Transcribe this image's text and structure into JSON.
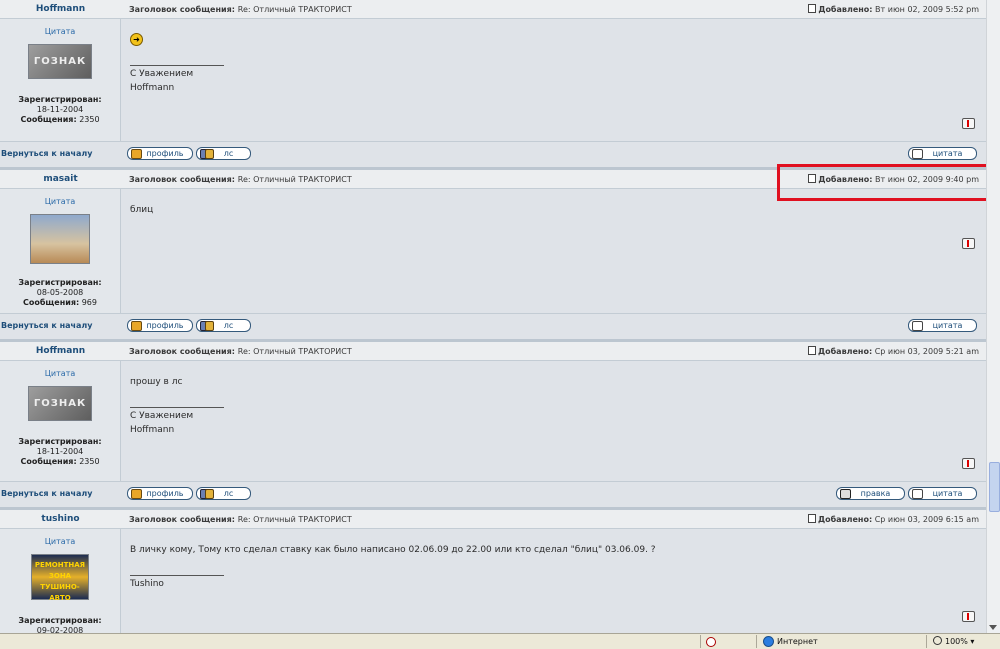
{
  "posts": [
    {
      "author": "Hoffmann",
      "rank": "Цитата",
      "avatar_text": "ГОЗНАК",
      "registered_label": "Зарегистрирован:",
      "registered": "18-11-2004",
      "posts_label": "Сообщения:",
      "posts_count": "2350",
      "subject_label": "Заголовок сообщения:",
      "subject": "Re: Отличный ТРАКТОРИСТ",
      "date_label": "Добавлено:",
      "date": "Вт июн 02, 2009 5:52 pm",
      "body": [],
      "signature": [
        "С Уважением",
        "Hoffmann"
      ]
    },
    {
      "author": "masait",
      "rank": "Цитата",
      "registered_label": "Зарегистрирован:",
      "registered": "08-05-2008",
      "posts_label": "Сообщения:",
      "posts_count": "969",
      "subject_label": "Заголовок сообщения:",
      "subject": "Re: Отличный ТРАКТОРИСТ",
      "date_label": "Добавлено:",
      "date": "Вт июн 02, 2009 9:40 pm",
      "body": [
        "блиц"
      ],
      "signature": []
    },
    {
      "author": "Hoffmann",
      "rank": "Цитата",
      "avatar_text": "ГОЗНАК",
      "registered_label": "Зарегистрирован:",
      "registered": "18-11-2004",
      "posts_label": "Сообщения:",
      "posts_count": "2350",
      "subject_label": "Заголовок сообщения:",
      "subject": "Re: Отличный ТРАКТОРИСТ",
      "date_label": "Добавлено:",
      "date": "Ср июн 03, 2009 5:21 am",
      "body": [
        "прошу в лс"
      ],
      "signature": [
        "С Уважением",
        "Hoffmann"
      ]
    },
    {
      "author": "tushino",
      "rank": "Цитата",
      "avatar_text": [
        "РЕМОНТНАЯ ЗОНА",
        "ТУШИНО-АВТО"
      ],
      "registered_label": "Зарегистрирован:",
      "registered": "09-02-2008",
      "subject_label": "Заголовок сообщения:",
      "subject": "Re: Отличный ТРАКТОРИСТ",
      "date_label": "Добавлено:",
      "date": "Ср июн 03, 2009 6:15 am",
      "body": [
        "В личку кому, Тому кто сделал ставку как было написано 02.06.09 до 22.00 или кто сделал \"блиц\" 03.06.09. ?"
      ],
      "signature": [
        "Tushino"
      ]
    }
  ],
  "footer": {
    "back_to_top": "Вернуться к началу",
    "profile_label": "профиль",
    "pm_label": "лс",
    "quote_label": "цитата",
    "edit_label": "правка"
  },
  "statusbar": {
    "zone": "Интернет",
    "zoom": "100%"
  },
  "colors": {
    "highlight": "#e01020",
    "link": "#1e4e7a"
  }
}
